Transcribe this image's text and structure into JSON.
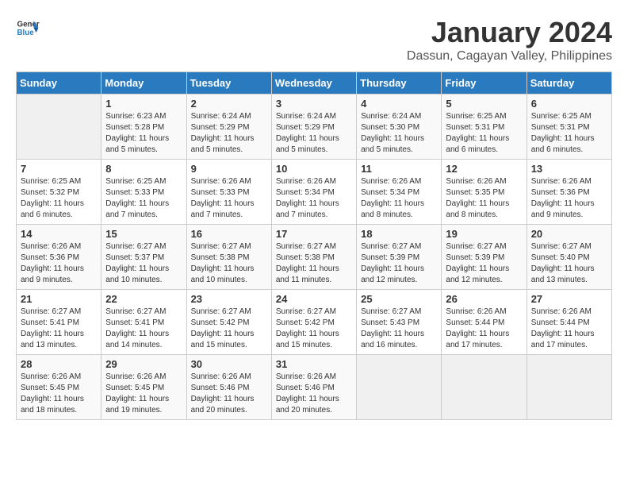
{
  "header": {
    "logo_general": "General",
    "logo_blue": "Blue",
    "month_title": "January 2024",
    "location": "Dassun, Cagayan Valley, Philippines"
  },
  "days_of_week": [
    "Sunday",
    "Monday",
    "Tuesday",
    "Wednesday",
    "Thursday",
    "Friday",
    "Saturday"
  ],
  "weeks": [
    [
      {
        "day": "",
        "empty": true
      },
      {
        "day": "1",
        "sunrise": "6:23 AM",
        "sunset": "5:28 PM",
        "daylight": "11 hours and 5 minutes."
      },
      {
        "day": "2",
        "sunrise": "6:24 AM",
        "sunset": "5:29 PM",
        "daylight": "11 hours and 5 minutes."
      },
      {
        "day": "3",
        "sunrise": "6:24 AM",
        "sunset": "5:29 PM",
        "daylight": "11 hours and 5 minutes."
      },
      {
        "day": "4",
        "sunrise": "6:24 AM",
        "sunset": "5:30 PM",
        "daylight": "11 hours and 5 minutes."
      },
      {
        "day": "5",
        "sunrise": "6:25 AM",
        "sunset": "5:31 PM",
        "daylight": "11 hours and 6 minutes."
      },
      {
        "day": "6",
        "sunrise": "6:25 AM",
        "sunset": "5:31 PM",
        "daylight": "11 hours and 6 minutes."
      }
    ],
    [
      {
        "day": "7",
        "sunrise": "6:25 AM",
        "sunset": "5:32 PM",
        "daylight": "11 hours and 6 minutes."
      },
      {
        "day": "8",
        "sunrise": "6:25 AM",
        "sunset": "5:33 PM",
        "daylight": "11 hours and 7 minutes."
      },
      {
        "day": "9",
        "sunrise": "6:26 AM",
        "sunset": "5:33 PM",
        "daylight": "11 hours and 7 minutes."
      },
      {
        "day": "10",
        "sunrise": "6:26 AM",
        "sunset": "5:34 PM",
        "daylight": "11 hours and 7 minutes."
      },
      {
        "day": "11",
        "sunrise": "6:26 AM",
        "sunset": "5:34 PM",
        "daylight": "11 hours and 8 minutes."
      },
      {
        "day": "12",
        "sunrise": "6:26 AM",
        "sunset": "5:35 PM",
        "daylight": "11 hours and 8 minutes."
      },
      {
        "day": "13",
        "sunrise": "6:26 AM",
        "sunset": "5:36 PM",
        "daylight": "11 hours and 9 minutes."
      }
    ],
    [
      {
        "day": "14",
        "sunrise": "6:26 AM",
        "sunset": "5:36 PM",
        "daylight": "11 hours and 9 minutes."
      },
      {
        "day": "15",
        "sunrise": "6:27 AM",
        "sunset": "5:37 PM",
        "daylight": "11 hours and 10 minutes."
      },
      {
        "day": "16",
        "sunrise": "6:27 AM",
        "sunset": "5:38 PM",
        "daylight": "11 hours and 10 minutes."
      },
      {
        "day": "17",
        "sunrise": "6:27 AM",
        "sunset": "5:38 PM",
        "daylight": "11 hours and 11 minutes."
      },
      {
        "day": "18",
        "sunrise": "6:27 AM",
        "sunset": "5:39 PM",
        "daylight": "11 hours and 12 minutes."
      },
      {
        "day": "19",
        "sunrise": "6:27 AM",
        "sunset": "5:39 PM",
        "daylight": "11 hours and 12 minutes."
      },
      {
        "day": "20",
        "sunrise": "6:27 AM",
        "sunset": "5:40 PM",
        "daylight": "11 hours and 13 minutes."
      }
    ],
    [
      {
        "day": "21",
        "sunrise": "6:27 AM",
        "sunset": "5:41 PM",
        "daylight": "11 hours and 13 minutes."
      },
      {
        "day": "22",
        "sunrise": "6:27 AM",
        "sunset": "5:41 PM",
        "daylight": "11 hours and 14 minutes."
      },
      {
        "day": "23",
        "sunrise": "6:27 AM",
        "sunset": "5:42 PM",
        "daylight": "11 hours and 15 minutes."
      },
      {
        "day": "24",
        "sunrise": "6:27 AM",
        "sunset": "5:42 PM",
        "daylight": "11 hours and 15 minutes."
      },
      {
        "day": "25",
        "sunrise": "6:27 AM",
        "sunset": "5:43 PM",
        "daylight": "11 hours and 16 minutes."
      },
      {
        "day": "26",
        "sunrise": "6:26 AM",
        "sunset": "5:44 PM",
        "daylight": "11 hours and 17 minutes."
      },
      {
        "day": "27",
        "sunrise": "6:26 AM",
        "sunset": "5:44 PM",
        "daylight": "11 hours and 17 minutes."
      }
    ],
    [
      {
        "day": "28",
        "sunrise": "6:26 AM",
        "sunset": "5:45 PM",
        "daylight": "11 hours and 18 minutes."
      },
      {
        "day": "29",
        "sunrise": "6:26 AM",
        "sunset": "5:45 PM",
        "daylight": "11 hours and 19 minutes."
      },
      {
        "day": "30",
        "sunrise": "6:26 AM",
        "sunset": "5:46 PM",
        "daylight": "11 hours and 20 minutes."
      },
      {
        "day": "31",
        "sunrise": "6:26 AM",
        "sunset": "5:46 PM",
        "daylight": "11 hours and 20 minutes."
      },
      {
        "day": "",
        "empty": true
      },
      {
        "day": "",
        "empty": true
      },
      {
        "day": "",
        "empty": true
      }
    ]
  ],
  "labels": {
    "sunrise_prefix": "Sunrise: ",
    "sunset_prefix": "Sunset: ",
    "daylight_prefix": "Daylight: "
  }
}
